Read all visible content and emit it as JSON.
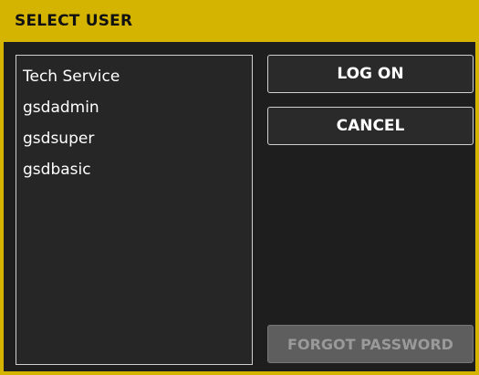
{
  "dialog": {
    "title": "SELECT USER"
  },
  "users": [
    {
      "label": "Tech Service"
    },
    {
      "label": "gsdadmin"
    },
    {
      "label": "gsdsuper"
    },
    {
      "label": "gsdbasic"
    }
  ],
  "buttons": {
    "log_on": "LOG ON",
    "cancel": "CANCEL",
    "forgot_password": "FORGOT PASSWORD"
  },
  "colors": {
    "accent": "#d4b400",
    "background": "#1e1e1e",
    "disabled_button": "#5e5e5e"
  }
}
